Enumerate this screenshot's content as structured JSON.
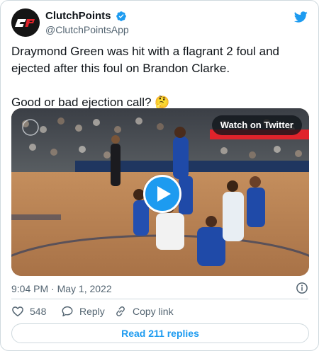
{
  "author": {
    "display_name": "ClutchPoints",
    "handle": "@ClutchPointsApp",
    "avatar_icon": "clutchpoints-logo",
    "verified_icon": "verified-badge-icon"
  },
  "tweet": {
    "text": "Draymond Green was hit with a flagrant 2 foul and ejected after this foul on Brandon Clarke.\n\nGood or bad ejection call? 🤔",
    "timestamp": "9:04 PM · May 1, 2022"
  },
  "media": {
    "watch_label": "Watch on Twitter",
    "play_icon": "play-icon"
  },
  "actions": {
    "like_count": "548",
    "reply_label": "Reply",
    "copy_link_label": "Copy link"
  },
  "read_replies_label": "Read 211 replies",
  "colors": {
    "accent": "#1d9bf0",
    "text": "#0f1419",
    "muted": "#536471",
    "border": "#cfd9de"
  }
}
